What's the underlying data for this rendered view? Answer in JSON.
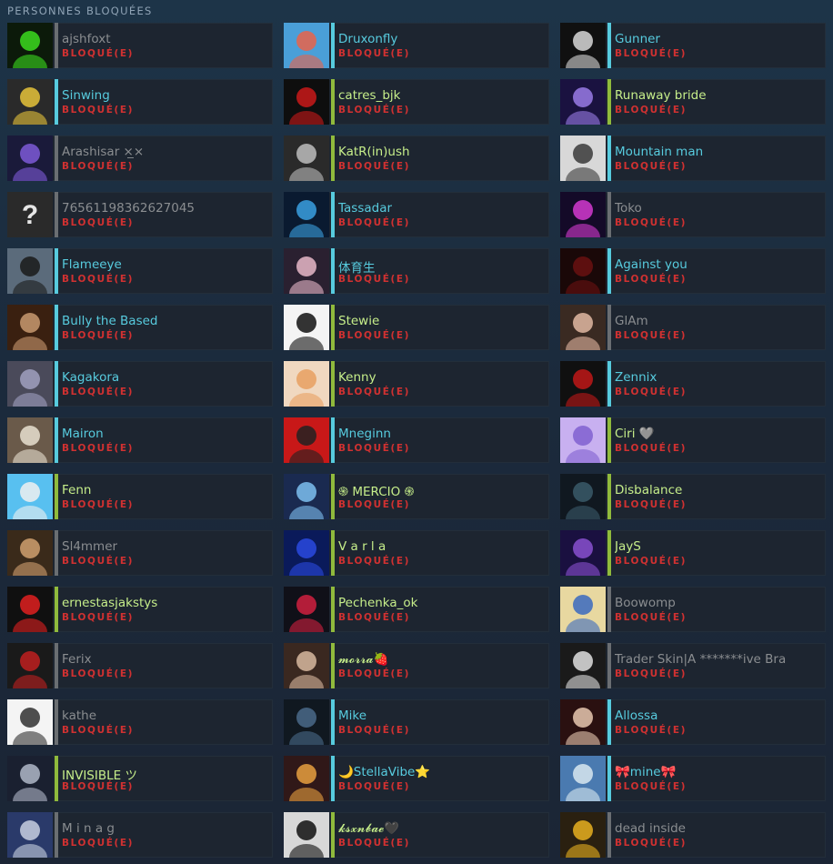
{
  "section": {
    "title": "PERSONNES BLOQUÉES"
  },
  "status_label": "BLOQUÉ(E)",
  "colors": {
    "online": "#57cbde",
    "ingame": "#90ba3c",
    "offline": "#6a6e72",
    "blocked": "#d03131"
  },
  "friends": [
    {
      "name": "ajshfoxt",
      "state": "offline",
      "avatar": [
        "#0c1a0a",
        "#3cdc1e"
      ]
    },
    {
      "name": "Druxonfly",
      "state": "online",
      "avatar": [
        "#4a9fd8",
        "#e9634a"
      ]
    },
    {
      "name": "Gunner",
      "state": "online",
      "avatar": [
        "#101010",
        "#d8d8d8"
      ]
    },
    {
      "name": "Sinwing",
      "state": "online",
      "avatar": [
        "#2a2a2a",
        "#e6c33a"
      ]
    },
    {
      "name": "catres_bjk",
      "state": "ingame",
      "avatar": [
        "#0e0e0e",
        "#c91919"
      ]
    },
    {
      "name": "Runaway bride",
      "state": "ingame",
      "avatar": [
        "#1a1240",
        "#9a7be6"
      ]
    },
    {
      "name": "Arashisar ×̲×",
      "state": "offline",
      "avatar": [
        "#1a1a3a",
        "#7e5ad8"
      ]
    },
    {
      "name": "KatR(in)ush",
      "state": "ingame",
      "avatar": [
        "#2a2a2a",
        "#bdbdbd"
      ]
    },
    {
      "name": "Mountain man",
      "state": "online",
      "avatar": [
        "#d8d8d8",
        "#3a3a3a"
      ]
    },
    {
      "name": "76561198362627045",
      "state": "offline",
      "avatar": [
        "#2a2a2a",
        "#e6e6e6"
      ]
    },
    {
      "name": "Tassadar",
      "state": "online",
      "avatar": [
        "#0a1a30",
        "#3aa0e0"
      ]
    },
    {
      "name": "Toko",
      "state": "offline",
      "avatar": [
        "#140a28",
        "#d43ad0"
      ]
    },
    {
      "name": "Flameeye",
      "state": "online",
      "avatar": [
        "#5b6b7b",
        "#1a1a1a"
      ]
    },
    {
      "name": "体育生",
      "state": "online",
      "avatar": [
        "#2a2030",
        "#e8b8c8"
      ]
    },
    {
      "name": "Against you",
      "state": "online",
      "avatar": [
        "#1a0808",
        "#6a1010"
      ]
    },
    {
      "name": "Bully the Based",
      "state": "online",
      "avatar": [
        "#3a2010",
        "#c99a70"
      ]
    },
    {
      "name": "Stewie",
      "state": "ingame",
      "avatar": [
        "#f4f4f4",
        "#111111"
      ]
    },
    {
      "name": "GlAm",
      "state": "offline",
      "avatar": [
        "#3a2a22",
        "#e2b8a2"
      ]
    },
    {
      "name": "Kagakora",
      "state": "online",
      "avatar": [
        "#4a4a5a",
        "#a0a0c0"
      ]
    },
    {
      "name": "Kenny",
      "state": "ingame",
      "avatar": [
        "#f0d8c0",
        "#e8a060"
      ]
    },
    {
      "name": "Zennix",
      "state": "online",
      "avatar": [
        "#101010",
        "#c01818"
      ]
    },
    {
      "name": "Mairon",
      "state": "online",
      "avatar": [
        "#6a5a4a",
        "#e8e0d0"
      ]
    },
    {
      "name": "Mneginn",
      "state": "online",
      "avatar": [
        "#c81818",
        "#222222"
      ]
    },
    {
      "name": "Ciri 🩶",
      "state": "ingame",
      "avatar": [
        "#c8b0f0",
        "#8060d0"
      ]
    },
    {
      "name": "Fenn",
      "state": "ingame",
      "avatar": [
        "#58c0f0",
        "#f0f0f0"
      ]
    },
    {
      "name": "֍ MERCIO ֍",
      "state": "ingame",
      "avatar": [
        "#1a2a50",
        "#7ec0f0"
      ]
    },
    {
      "name": "Disbalance",
      "state": "ingame",
      "avatar": [
        "#101820",
        "#3a5a6a"
      ]
    },
    {
      "name": "Sl4mmer",
      "state": "offline",
      "avatar": [
        "#3a2a1a",
        "#d0a070"
      ]
    },
    {
      "name": "V a r l a",
      "state": "ingame",
      "avatar": [
        "#0a1a5a",
        "#2a4ae0"
      ]
    },
    {
      "name": "JayS",
      "state": "ingame",
      "avatar": [
        "#1a1040",
        "#8a50d0"
      ]
    },
    {
      "name": "ernestasjakstys",
      "state": "ingame",
      "avatar": [
        "#101010",
        "#e02020"
      ]
    },
    {
      "name": "Pechenka_ok",
      "state": "ingame",
      "avatar": [
        "#101018",
        "#d02040"
      ]
    },
    {
      "name": "Boowomp",
      "state": "offline",
      "avatar": [
        "#e8d8a0",
        "#3a6ac0"
      ]
    },
    {
      "name": "Ferix",
      "state": "offline",
      "avatar": [
        "#1a1a1a",
        "#c02020"
      ]
    },
    {
      "name": "𝓶𝓸𝓻𝓻𝓪🍓",
      "state": "ingame",
      "avatar": [
        "#3a2820",
        "#d8b8a0"
      ]
    },
    {
      "name": "Trader Skin|A *******ive Bra",
      "state": "offline",
      "avatar": [
        "#1a1a1a",
        "#e0e0e0"
      ]
    },
    {
      "name": "kathe",
      "state": "offline",
      "avatar": [
        "#f4f4f4",
        "#303030"
      ]
    },
    {
      "name": "Mike",
      "state": "online",
      "avatar": [
        "#101820",
        "#4a6a8a"
      ]
    },
    {
      "name": "Allossa",
      "state": "online",
      "avatar": [
        "#2a1010",
        "#e8c8b0"
      ]
    },
    {
      "name": "INVISIBLE ツ",
      "state": "ingame",
      "avatar": [
        "#1a2030",
        "#b0b8c8"
      ]
    },
    {
      "name": "🌙StellaVibe⭐",
      "state": "online",
      "avatar": [
        "#301818",
        "#e8a040"
      ]
    },
    {
      "name": "🎀mine🎀",
      "state": "online",
      "avatar": [
        "#4a7ab0",
        "#d8e8f0"
      ]
    },
    {
      "name": "M i n a g",
      "state": "offline",
      "avatar": [
        "#2a3a6a",
        "#c8d0e0"
      ]
    },
    {
      "name": "𝓴𝓼𝔁𝓷𝓫𝓪𝓮🖤",
      "state": "ingame",
      "avatar": [
        "#d8d8d8",
        "#101010"
      ]
    },
    {
      "name": "dead inside",
      "state": "offline",
      "avatar": [
        "#2a2010",
        "#e8b020"
      ]
    }
  ]
}
